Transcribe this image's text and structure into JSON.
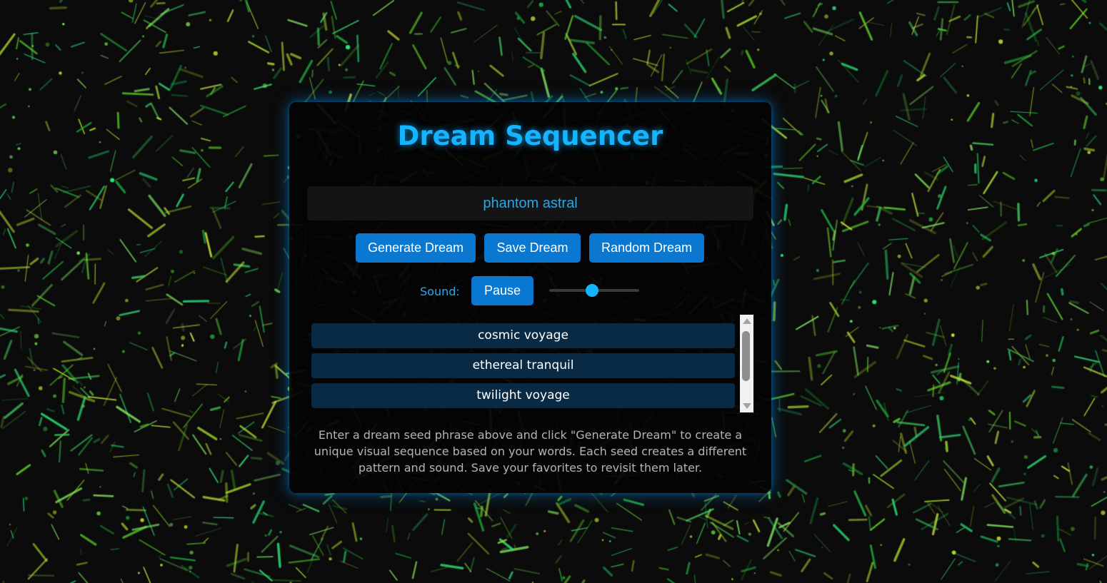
{
  "app": {
    "title": "Dream Sequencer"
  },
  "seed_input": {
    "value": "phantom astral"
  },
  "buttons": {
    "generate": "Generate Dream",
    "save": "Save Dream",
    "random": "Random Dream",
    "pause": "Pause"
  },
  "sound": {
    "label": "Sound:",
    "volume": 0.48
  },
  "saved_dreams": [
    "cosmic voyage",
    "ethereal tranquil",
    "twilight voyage"
  ],
  "instructions": "Enter a dream seed phrase above and click \"Generate Dream\" to create a unique visual sequence based on your words. Each seed creates a different pattern and sound. Save your favorites to revisit them later.",
  "colors": {
    "accent": "#14b4ff",
    "button": "#0a78d0",
    "list_item": "#082a45",
    "background": "#0b0b0b",
    "particles": [
      "#1fae3e",
      "#5ccc2a",
      "#2de07a",
      "#a6d62a",
      "#3fbf5a",
      "#7fe05f",
      "#c8e43a"
    ]
  },
  "icons": {
    "scroll_up": "chevron-up-icon",
    "scroll_down": "chevron-down-icon"
  }
}
